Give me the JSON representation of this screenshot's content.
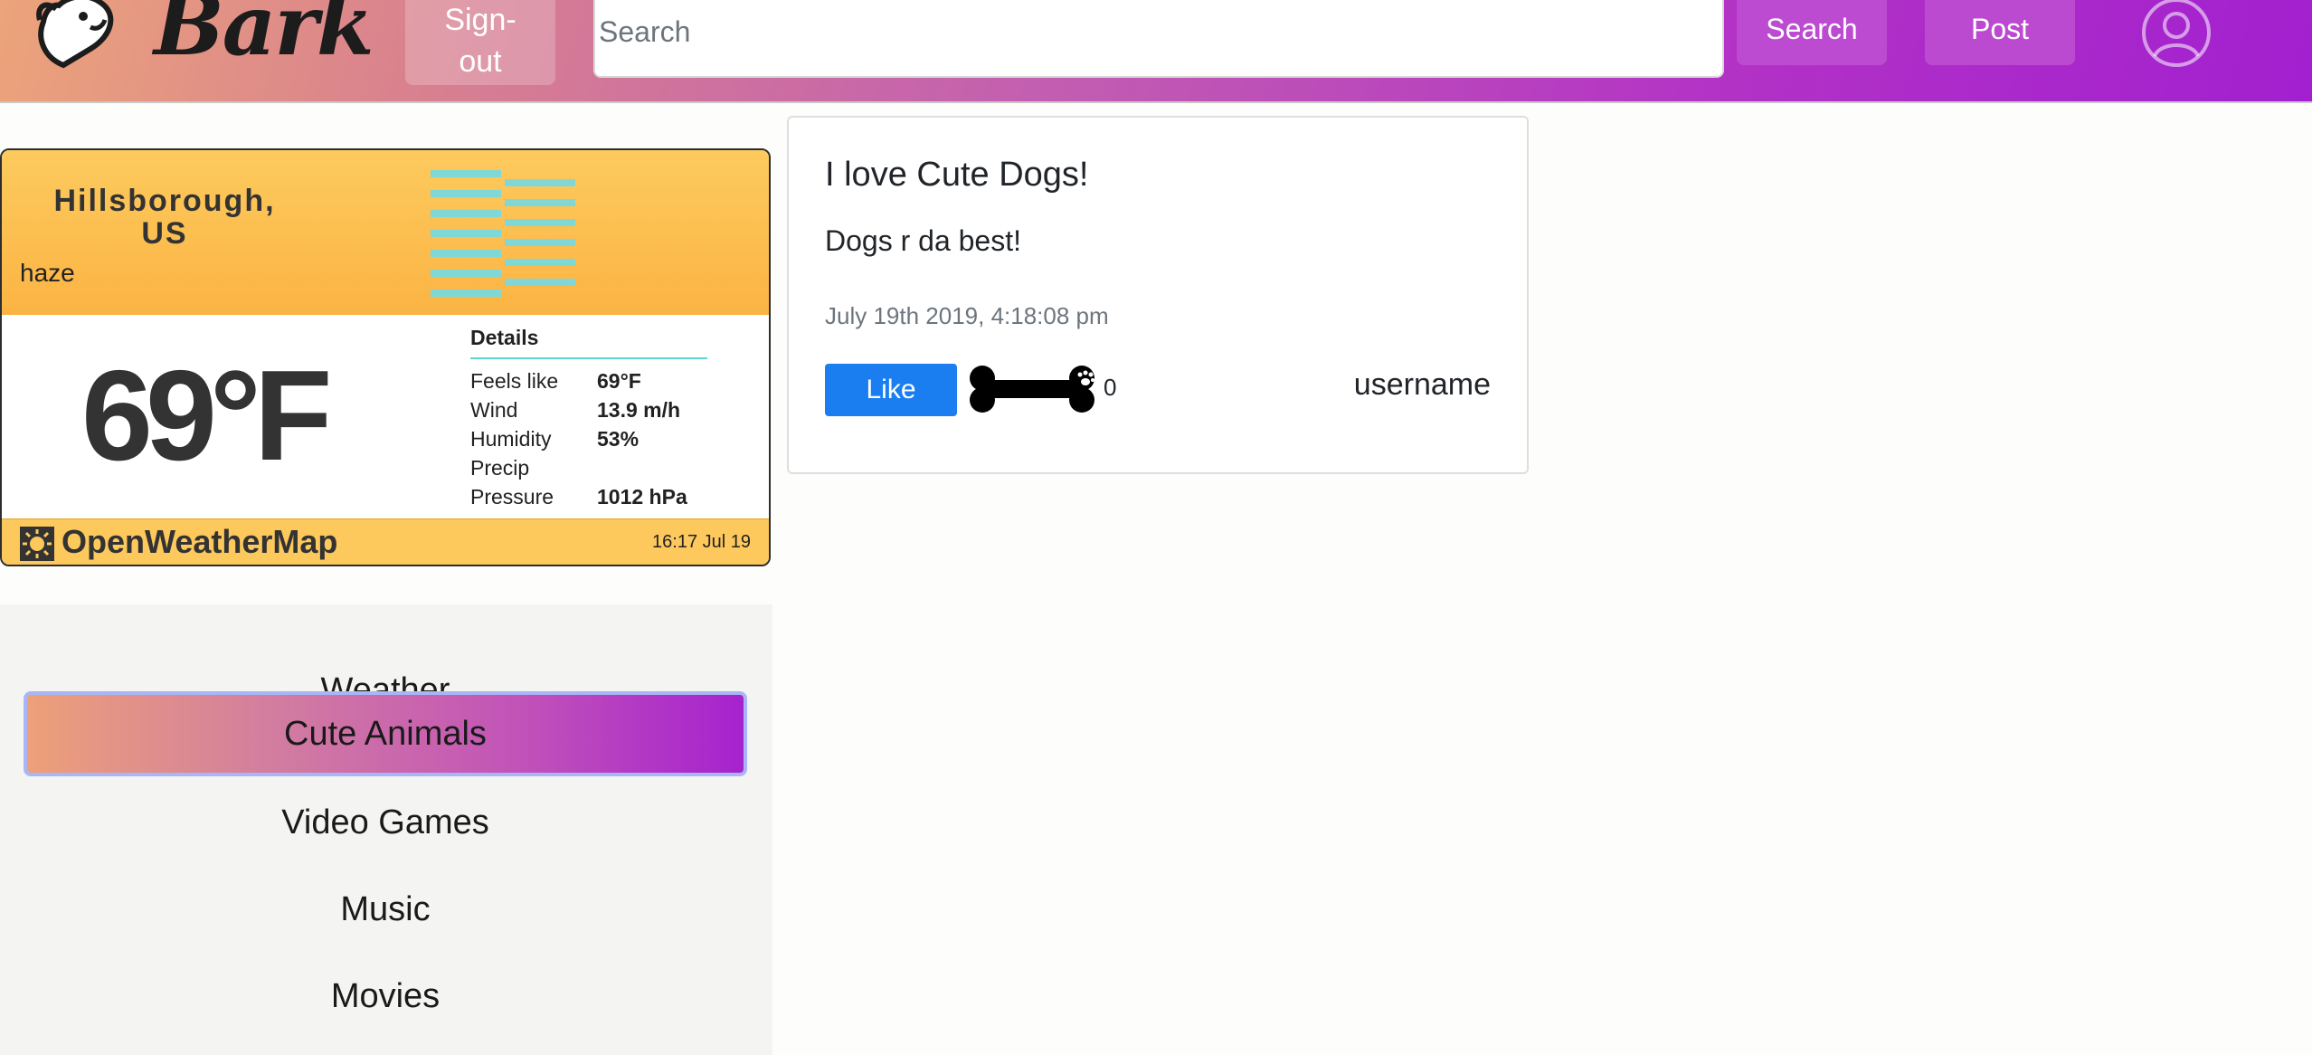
{
  "header": {
    "logo_text": "Bark",
    "signout_label": "Sign-\nout",
    "search_placeholder": "Search",
    "search_button": "Search",
    "post_button": "Post"
  },
  "weather": {
    "city": "Hillsborough, US",
    "description": "haze",
    "temperature": "69°F",
    "details_title": "Details",
    "rows": [
      {
        "label": "Feels like",
        "value": "69°F"
      },
      {
        "label": "Wind",
        "value": "13.9 m/h"
      },
      {
        "label": "Humidity",
        "value": "53%"
      },
      {
        "label": "Precip",
        "value": ""
      },
      {
        "label": "Pressure",
        "value": "1012 hPa"
      }
    ],
    "provider": "OpenWeatherMap",
    "updated": "16:17 Jul 19",
    "icon": "haze-lines-icon"
  },
  "categories": {
    "items": [
      "Weather",
      "Cute Animals",
      "Video Games",
      "Music",
      "Movies"
    ],
    "selected": "Cute Animals"
  },
  "post": {
    "title": "I love Cute Dogs!",
    "body": "Dogs r da best!",
    "date": "July 19th 2019, 4:18:08 pm",
    "like_label": "Like",
    "like_count": "0",
    "author": "username"
  },
  "colors": {
    "like_button": "#1a7ef0",
    "header_gradient_start": "#eca47a",
    "header_gradient_end": "#a220cf",
    "weather_accent": "#fbb443"
  }
}
